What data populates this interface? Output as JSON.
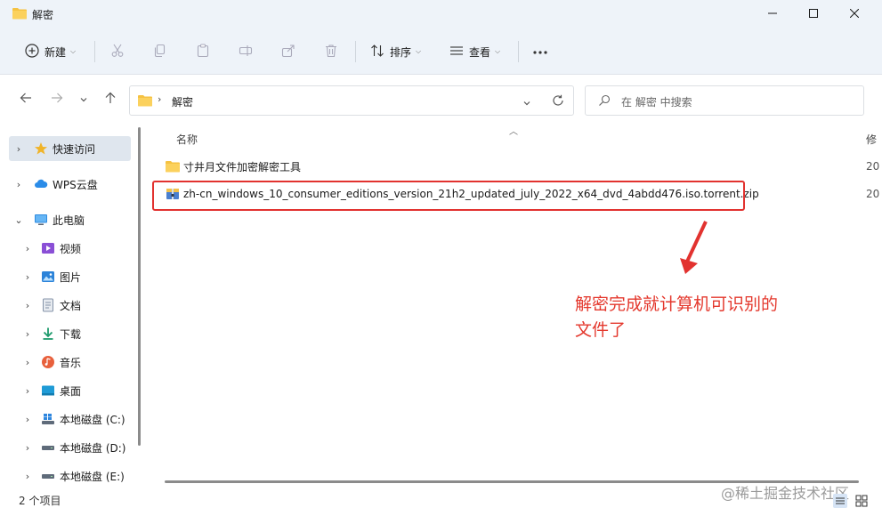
{
  "window": {
    "title": "解密",
    "controls": {
      "minimize": "minimize-icon",
      "maximize": "maximize-icon",
      "close": "close-icon"
    }
  },
  "toolbar": {
    "new_label": "新建",
    "sort_label": "排序",
    "view_label": "查看",
    "icons": [
      "cut-icon",
      "copy-icon",
      "paste-icon",
      "rename-icon",
      "share-icon",
      "delete-icon",
      "more-icon"
    ]
  },
  "address": {
    "path": "解密",
    "search_placeholder": "在 解密 中搜索"
  },
  "nav": {
    "items": [
      {
        "label": "快速访问",
        "icon": "star-icon"
      },
      {
        "label": "WPS云盘",
        "icon": "cloud-icon"
      },
      {
        "label": "此电脑",
        "icon": "computer-icon"
      },
      {
        "label": "视频",
        "icon": "video-icon"
      },
      {
        "label": "图片",
        "icon": "picture-icon"
      },
      {
        "label": "文档",
        "icon": "document-icon"
      },
      {
        "label": "下载",
        "icon": "download-icon"
      },
      {
        "label": "音乐",
        "icon": "music-icon"
      },
      {
        "label": "桌面",
        "icon": "desktop-icon"
      },
      {
        "label": "本地磁盘 (C:)",
        "icon": "drive-icon"
      },
      {
        "label": "本地磁盘 (D:)",
        "icon": "drive-icon"
      },
      {
        "label": "本地磁盘 (E:)",
        "icon": "drive-icon"
      }
    ]
  },
  "content": {
    "columns": {
      "name": "名称",
      "modified": "修"
    },
    "files": [
      {
        "name": "寸井月文件加密解密工具",
        "date": "20",
        "icon": "folder-icon"
      },
      {
        "name": "zh-cn_windows_10_consumer_editions_version_21h2_updated_july_2022_x64_dvd_4abdd476.iso.torrent.zip",
        "date": "20",
        "icon": "zip-icon"
      }
    ]
  },
  "annotation": {
    "line1": "解密完成就计算机可识别的",
    "line2": "文件了",
    "color": "#e4382d"
  },
  "status": {
    "count": "2 个项目",
    "watermark": "@稀土掘金技术社区"
  },
  "colors": {
    "accent": "#0067c0",
    "highlight": "#e2322f",
    "folder": "#f5c242"
  }
}
